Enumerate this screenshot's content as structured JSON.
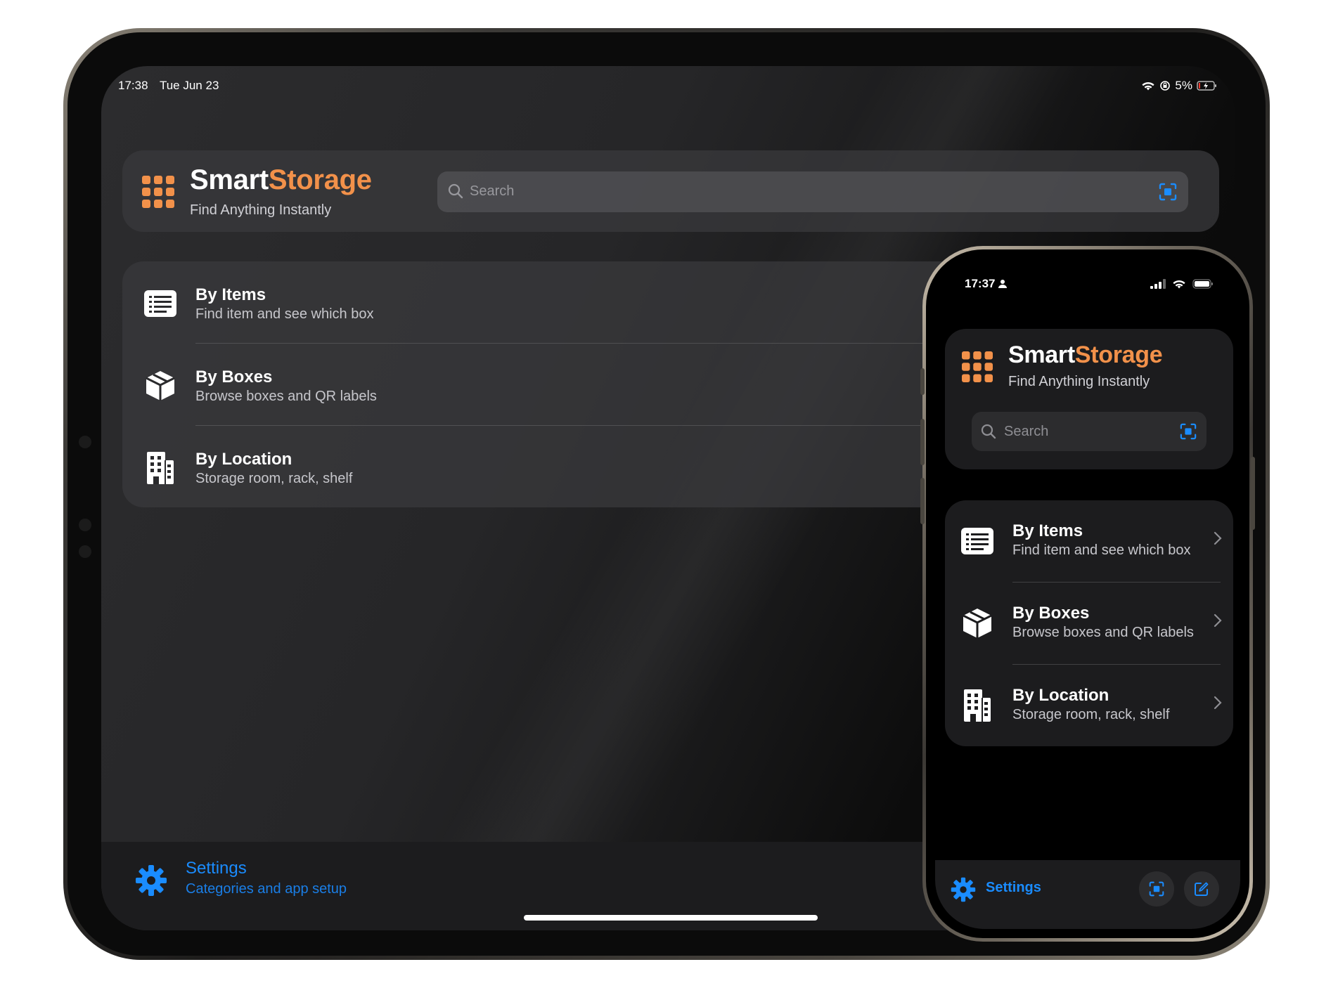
{
  "app": {
    "title_part1": "Smart",
    "title_part2": "Storage",
    "subtitle": "Find Anything Instantly"
  },
  "tablet": {
    "status": {
      "time": "17:38",
      "date": "Tue Jun 23",
      "battery": "5%"
    },
    "search": {
      "placeholder": "Search"
    },
    "menu": [
      {
        "title": "By Items",
        "subtitle": "Find item and see which box",
        "icon": "list-icon"
      },
      {
        "title": "By Boxes",
        "subtitle": "Browse boxes and QR labels",
        "icon": "box-icon"
      },
      {
        "title": "By Location",
        "subtitle": "Storage room, rack, shelf",
        "icon": "building-icon"
      }
    ],
    "settings": {
      "title": "Settings",
      "subtitle": "Categories and app setup"
    }
  },
  "phone": {
    "status": {
      "time": "17:37"
    },
    "search": {
      "placeholder": "Search"
    },
    "menu": [
      {
        "title": "By Items",
        "subtitle": "Find item and see which box",
        "icon": "list-icon"
      },
      {
        "title": "By Boxes",
        "subtitle": "Browse boxes and QR labels",
        "icon": "box-icon"
      },
      {
        "title": "By Location",
        "subtitle": "Storage room, rack, shelf",
        "icon": "building-icon"
      }
    ],
    "settings": {
      "title": "Settings"
    }
  },
  "colors": {
    "accent_orange": "#f2914a",
    "accent_blue": "#1a8cff",
    "card_bg": "#1c1c1e"
  }
}
